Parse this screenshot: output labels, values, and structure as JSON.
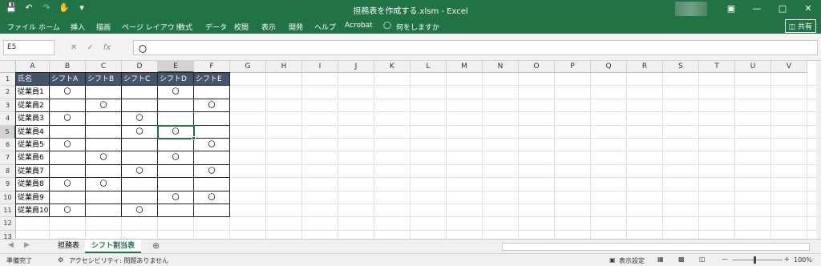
{
  "window": {
    "title": "担務表を作成する.xlsm  -  Excel",
    "qat_icons": [
      "save-icon",
      "undo-icon",
      "redo-icon",
      "touch-mode-icon",
      "customize-qat-icon"
    ],
    "buttons": [
      "ribbon-display-options-icon",
      "minimize-icon",
      "maximize-icon",
      "close-icon"
    ]
  },
  "menu": {
    "items": [
      "ファイル",
      "ホーム",
      "挿入",
      "描画",
      "ページ レイアウト",
      "数式",
      "データ",
      "校閲",
      "表示",
      "開発",
      "ヘルプ",
      "Acrobat"
    ],
    "tellme": "何をしますか",
    "share": "共有"
  },
  "formula_bar": {
    "name_box": "E5",
    "content": "〇"
  },
  "sheet": {
    "columns": [
      "A",
      "B",
      "C",
      "D",
      "E",
      "F",
      "G",
      "H",
      "I",
      "J",
      "K",
      "L",
      "M",
      "N",
      "O",
      "P",
      "Q",
      "R",
      "S",
      "T",
      "U",
      "V"
    ],
    "rows": [
      "1",
      "2",
      "3",
      "4",
      "5",
      "6",
      "7",
      "8",
      "9",
      "10",
      "11",
      "12",
      "13"
    ],
    "header": [
      "氏名",
      "シフトA",
      "シフトB",
      "シフトC",
      "シフトD",
      "シフトE"
    ],
    "data": [
      [
        "従業員1",
        "〇",
        "",
        "",
        "〇",
        ""
      ],
      [
        "従業員2",
        "",
        "〇",
        "",
        "",
        "〇"
      ],
      [
        "従業員3",
        "〇",
        "",
        "〇",
        "",
        ""
      ],
      [
        "従業員4",
        "",
        "",
        "〇",
        "〇",
        ""
      ],
      [
        "従業員5",
        "〇",
        "",
        "",
        "",
        "〇"
      ],
      [
        "従業員6",
        "",
        "〇",
        "",
        "〇",
        ""
      ],
      [
        "従業員7",
        "",
        "",
        "〇",
        "",
        "〇"
      ],
      [
        "従業員8",
        "〇",
        "〇",
        "",
        "",
        ""
      ],
      [
        "従業員9",
        "",
        "",
        "",
        "〇",
        "〇"
      ],
      [
        "従業員10",
        "〇",
        "",
        "〇",
        "",
        ""
      ]
    ],
    "header_bg": "#44546a",
    "selected_cell": "E5"
  },
  "tabs": {
    "items": [
      "担務表",
      "シフト割当表"
    ],
    "active": "シフト割当表"
  },
  "status": {
    "ready": "準備完了",
    "accessibility": "アクセシビリティ: 問題ありません",
    "display_settings": "表示設定",
    "zoom": "100%"
  },
  "colors": {
    "excel_green": "#217346",
    "selection_green": "#217346"
  }
}
